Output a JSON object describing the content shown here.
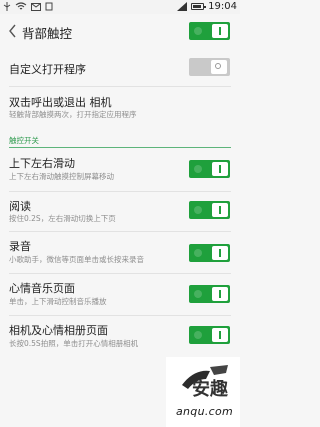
{
  "status_bar": {
    "time": "19:04",
    "icons": [
      "wifi-icon",
      "signal-icon",
      "battery-icon"
    ]
  },
  "header": {
    "title": "背部触控",
    "master_toggle": true
  },
  "custom_open_app": {
    "title": "自定义打开程序",
    "toggle": false
  },
  "double_tap_camera": {
    "title": "双击呼出或退出 相机",
    "subtitle": "轻触背部触摸两次，打开指定应用程序"
  },
  "section": {
    "label": "触控开关"
  },
  "items": [
    {
      "title": "上下左右滑动",
      "subtitle": "上下左右滑动触摸控制屏幕移动",
      "toggle": true
    },
    {
      "title": "阅读",
      "subtitle": "按住0.2S，左右滑动切换上下页",
      "toggle": true
    },
    {
      "title": "录音",
      "subtitle": "小歌助手，微信等页面单击或长按来录音",
      "toggle": true
    },
    {
      "title": "心情音乐页面",
      "subtitle": "单击，上下滑动控制音乐播放",
      "toggle": true
    },
    {
      "title": "相机及心情相册页面",
      "subtitle": "长按0.5S拍照，单击打开心情相册相机",
      "toggle": true
    }
  ],
  "watermark": {
    "text": "anqu.com",
    "logo_text": "安趣"
  }
}
